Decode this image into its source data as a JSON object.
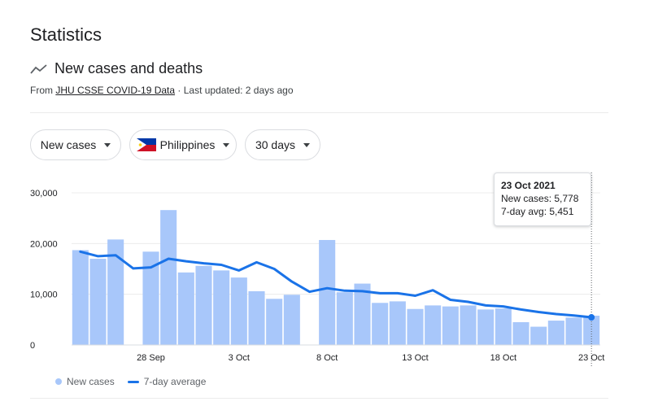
{
  "page": {
    "title": "Statistics",
    "section_title": "New cases and deaths",
    "source_prefix": "From ",
    "source_link": "JHU CSSE COVID-19 Data",
    "source_suffix": " · Last updated: 2 days ago"
  },
  "filters": {
    "metric": "New cases",
    "country": "Philippines",
    "range": "30 days"
  },
  "tooltip": {
    "date": "23 Oct 2021",
    "new_cases": "New cases: 5,778",
    "avg": "7-day avg: 5,451"
  },
  "legend": {
    "bars_label": "New cases",
    "line_label": "7-day average"
  },
  "colors": {
    "bar": "#a8c7fa",
    "line": "#1a73e8",
    "grid": "#ececec"
  },
  "chart_data": {
    "type": "bar",
    "title": "",
    "xlabel": "",
    "ylabel": "",
    "x_ticks": [
      "28 Sep",
      "3 Oct",
      "8 Oct",
      "13 Oct",
      "18 Oct",
      "23 Oct"
    ],
    "x_tick_days": [
      5,
      10,
      15,
      20,
      25,
      30
    ],
    "y_ticks": [
      "0",
      "10,000",
      "20,000",
      "30,000"
    ],
    "y_tick_values": [
      0,
      10000,
      20000,
      30000
    ],
    "ylim": [
      0,
      30000
    ],
    "days": [
      1,
      2,
      3,
      4,
      5,
      6,
      7,
      8,
      9,
      10,
      11,
      12,
      13,
      14,
      15,
      16,
      17,
      18,
      19,
      20,
      21,
      22,
      23,
      24,
      25,
      26,
      27,
      28,
      29,
      30
    ],
    "series": [
      {
        "name": "New cases",
        "type": "bar",
        "values": [
          18700,
          17000,
          20800,
          null,
          18400,
          26600,
          14300,
          15600,
          14700,
          13300,
          10600,
          9100,
          9900,
          null,
          20700,
          10400,
          12100,
          8300,
          8600,
          7100,
          7800,
          7600,
          7800,
          7000,
          7200,
          4500,
          3600,
          4800,
          5400,
          5778
        ]
      },
      {
        "name": "7-day average",
        "type": "line",
        "values": [
          18400,
          17500,
          17700,
          15100,
          15300,
          17000,
          16500,
          16100,
          15800,
          14700,
          16300,
          15000,
          12500,
          10500,
          11200,
          10700,
          10600,
          10200,
          10200,
          9700,
          10800,
          8900,
          8500,
          7800,
          7600,
          7000,
          6500,
          6100,
          5800,
          5451
        ]
      }
    ],
    "highlight_day": 30
  }
}
